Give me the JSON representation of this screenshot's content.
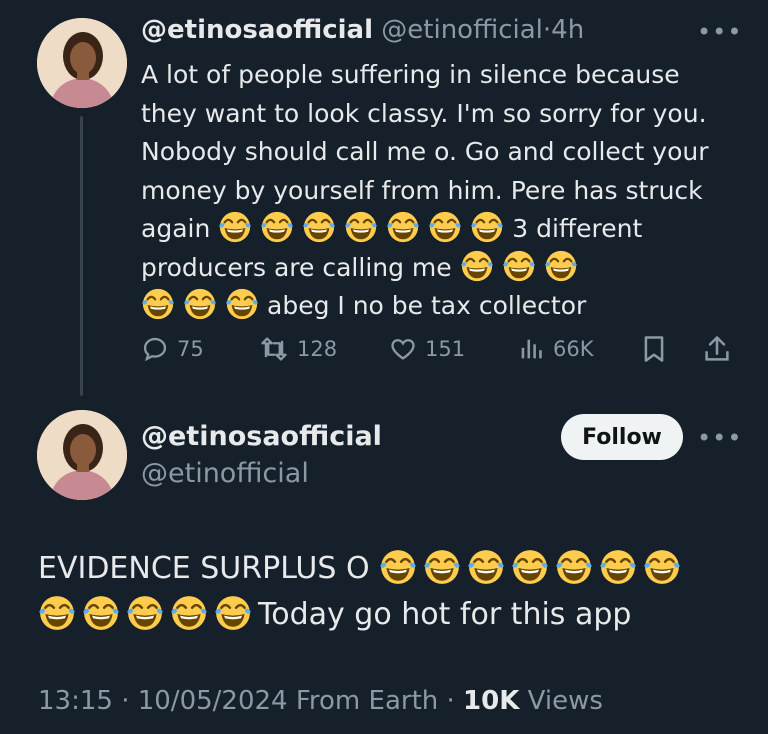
{
  "quoted_tweet": {
    "display_name": "@etinosaofficial",
    "handle": "@etinofficial",
    "separator": "·",
    "time": "4h",
    "more_icon": "more-horizontal-icon",
    "text_line1": "A lot of people suffering in silence because they want to look classy. I'm so sorry for you. Nobody should call me o. Go and collect your money by yourself from him. Pere has struck again",
    "text_line2": "3 different producers are calling me",
    "text_line3": "abeg I no be tax collector",
    "emoji": "face-with-tears-of-joy",
    "emoji_counts": [
      7,
      3,
      3
    ],
    "actions": {
      "replies": "75",
      "reposts": "128",
      "likes": "151",
      "views": "66K"
    }
  },
  "main_tweet": {
    "display_name": "@etinosaofficial",
    "handle": "@etinofficial",
    "follow_label": "Follow",
    "more_icon": "more-horizontal-icon",
    "text_part1": "EVIDENCE SURPLUS O",
    "text_part2": "Today go hot for this app",
    "emoji_counts": [
      7,
      5
    ],
    "timestamp": "13:15 · 10/05/2024 From Earth ·",
    "views_count": "10K",
    "views_label": "Views"
  },
  "colors": {
    "background": "#15202b",
    "text": "#e7e9ea",
    "muted": "#8b98a5",
    "thread_line": "#38444d",
    "follow_bg": "#eff3f4"
  }
}
